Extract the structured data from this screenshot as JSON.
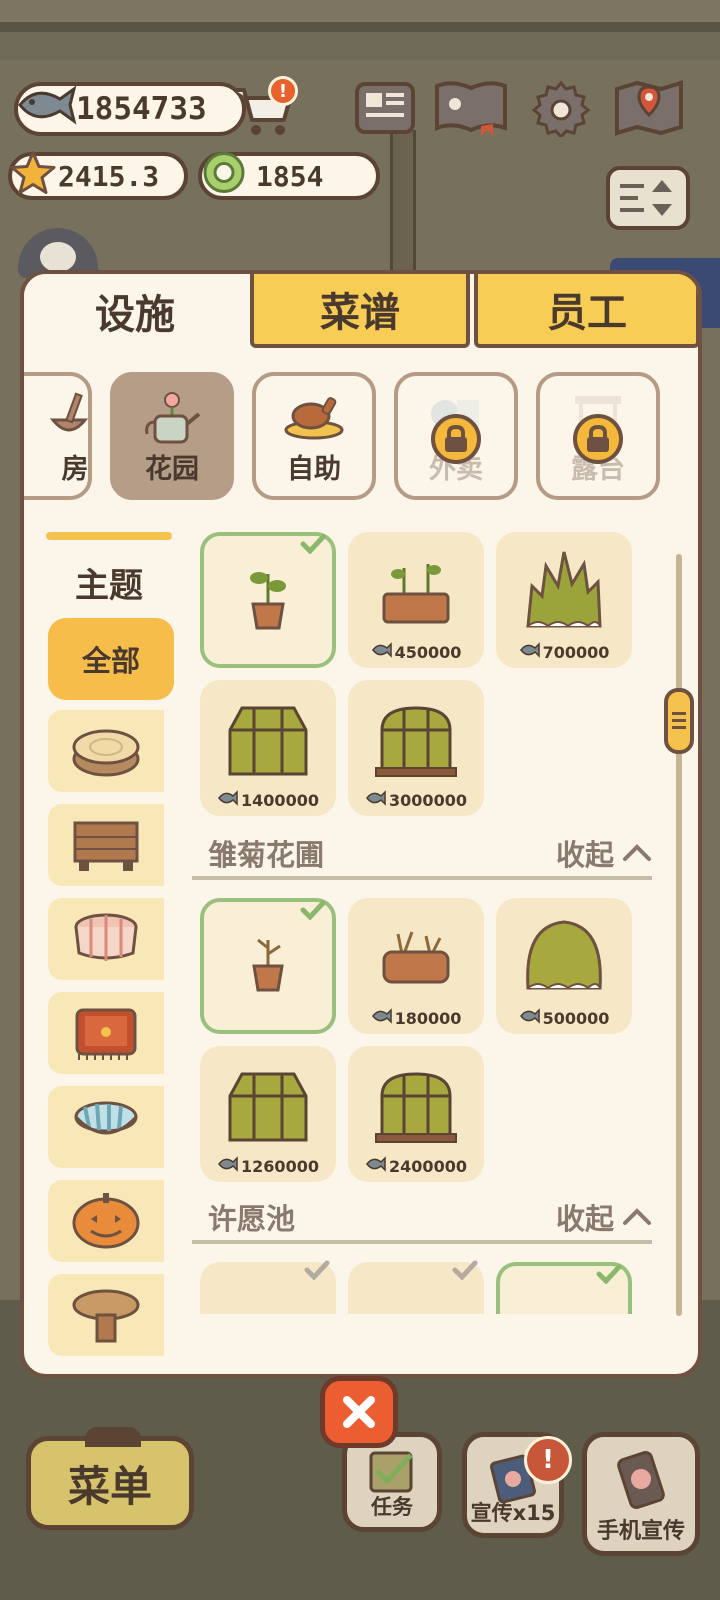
{
  "currency": {
    "fish": "1854733",
    "stars": "2415.3",
    "rings": "1854"
  },
  "header": {
    "cart_badge": "!"
  },
  "tabs": [
    {
      "label": "设施"
    },
    {
      "label": "菜谱"
    },
    {
      "label": "员工"
    }
  ],
  "categories": [
    {
      "label": "房",
      "locked": false,
      "selected": false
    },
    {
      "label": "花园",
      "locked": false,
      "selected": true
    },
    {
      "label": "自助",
      "locked": false,
      "selected": false
    },
    {
      "label": "外卖",
      "locked": true,
      "selected": false
    },
    {
      "label": "露台",
      "locked": true,
      "selected": false
    }
  ],
  "theme": {
    "title": "主题",
    "all_label": "全部"
  },
  "sections": [
    {
      "items": [
        {
          "owned": true,
          "price": ""
        },
        {
          "owned": false,
          "price": "450000"
        },
        {
          "owned": false,
          "price": "700000"
        },
        {
          "owned": false,
          "price": "1400000"
        },
        {
          "owned": false,
          "price": "3000000"
        }
      ]
    },
    {
      "title": "雏菊花圃",
      "fold_label": "收起",
      "items": [
        {
          "owned": true,
          "price": ""
        },
        {
          "owned": false,
          "price": "180000"
        },
        {
          "owned": false,
          "price": "500000"
        },
        {
          "owned": false,
          "price": "1260000"
        },
        {
          "owned": false,
          "price": "2400000"
        }
      ]
    },
    {
      "title": "许愿池",
      "fold_label": "收起"
    }
  ],
  "bottom": {
    "menu_label": "菜单",
    "tasks_label": "任务",
    "promote_label": "宣传x15",
    "phone_promote_label": "手机宣传",
    "promote_badge": "!"
  },
  "colors": {
    "accent_yellow": "#f6c24e",
    "owned_green": "#9ac07e",
    "panel_bg": "#fbf5ea",
    "border_brown": "#6e5140",
    "close_orange": "#ec5e32"
  }
}
